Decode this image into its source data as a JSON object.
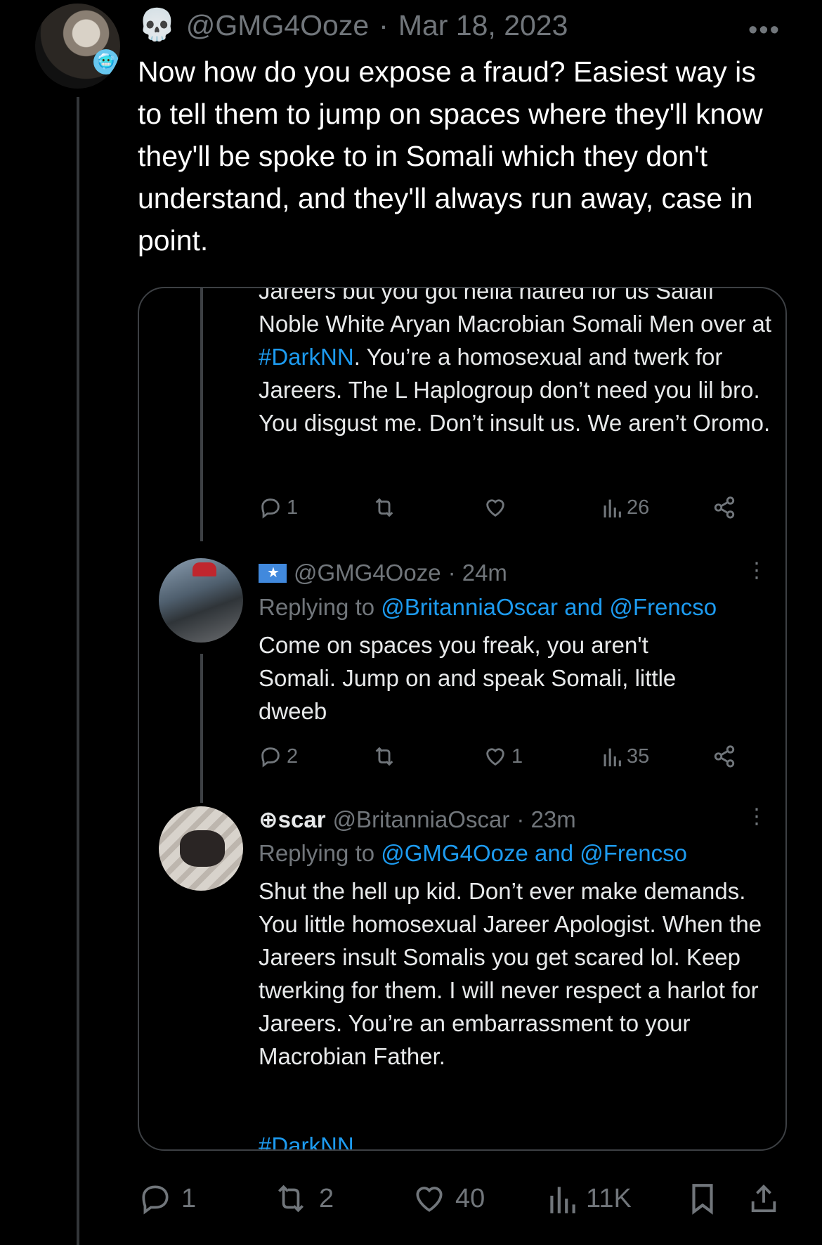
{
  "tweet": {
    "handle": "@GMG4Ooze",
    "separator": "·",
    "date": "Mar 18, 2023",
    "skull_emoji": "💀",
    "badge_emoji": "🥶",
    "more": "•••",
    "text": "Now how do you expose a fraud? Easiest way is to tell them to jump on spaces where they'll know they'll be spoke to in Somali which they don't understand, and they'll always run away, case in point."
  },
  "quoted": {
    "first": {
      "text_part1": "Jareers but you got hella hatred for us Salafi Noble White Aryan Macrobian Somali Men over at ",
      "hashtag": "#DarkNN",
      "text_part2": ". You’re a homosexual and twerk for Jareers. The L Haplogroup don’t need you lil bro. You disgust me. Don’t insult us. We aren’t Oromo.",
      "replies": "1",
      "views": "26"
    },
    "reply1": {
      "handle": "@GMG4Ooze",
      "time": "· 24m",
      "replying_prefix": "Replying to ",
      "replying_to": "@BritanniaOscar and @Frencso",
      "text": "Come on spaces you freak, you aren't Somali. Jump on and speak Somali, little dweeb",
      "replies": "2",
      "likes": "1",
      "views": "35"
    },
    "reply2": {
      "name": "⊕scar",
      "handle": "@BritanniaOscar",
      "time": "· 23m",
      "replying_prefix": "Replying to ",
      "replying_to": "@GMG4Ooze and @Frencso",
      "text": "Shut the hell up kid. Don’t ever make demands. You little homosexual Jareer Apologist. When the Jareers insult Somalis you get scared lol. Keep twerking for them. I will never respect a harlot for Jareers. You’re an embarrassment to your Macrobian Father.",
      "hashtag_cut": "#DarkNN"
    },
    "kebab": "⋮"
  },
  "actions": {
    "replies": "1",
    "retweets": "2",
    "likes": "40",
    "views": "11K"
  }
}
